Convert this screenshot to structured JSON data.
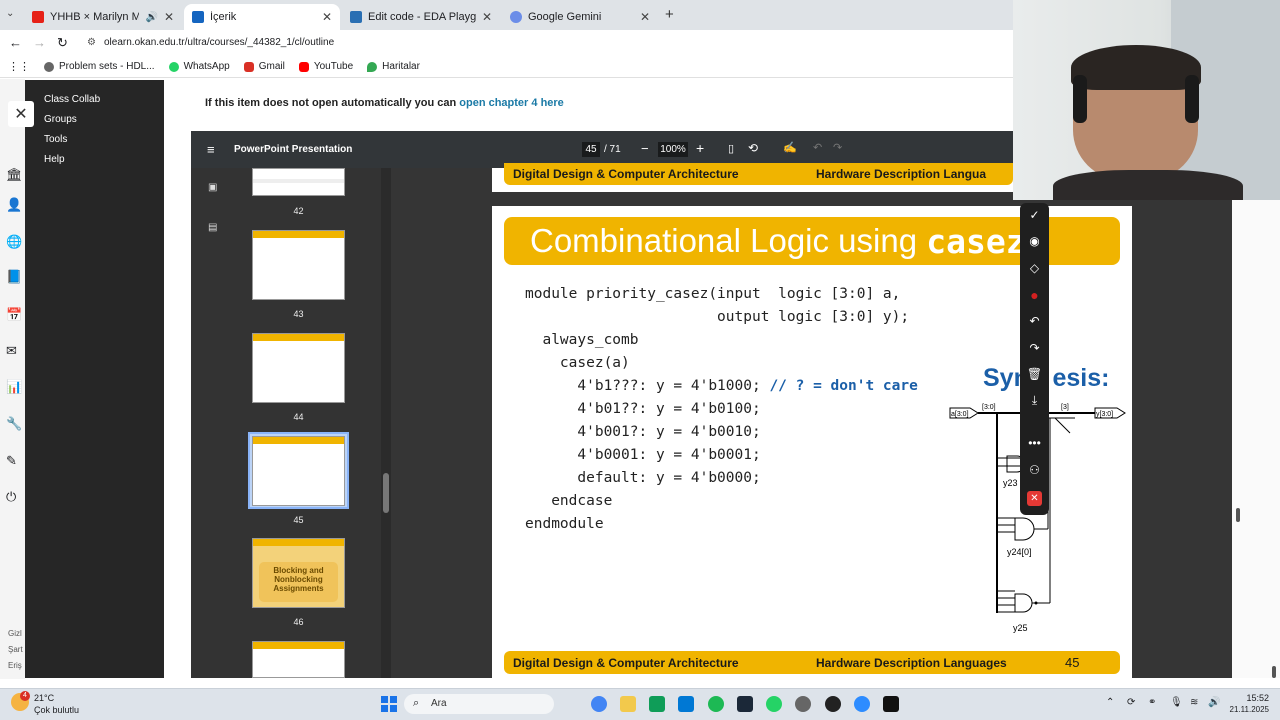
{
  "browser": {
    "tabs": [
      {
        "title": "YHHB × Marilyn Manson (n",
        "active": false,
        "audio": true
      },
      {
        "title": "İçerik",
        "active": true
      },
      {
        "title": "Edit code - EDA Playground",
        "active": false
      },
      {
        "title": "Google Gemini",
        "active": false
      }
    ],
    "url": "olearn.okan.edu.tr/ultra/courses/_44382_1/cl/outline",
    "bookmarks": [
      "Problem sets - HDL...",
      "WhatsApp",
      "Gmail",
      "YouTube",
      "Haritalar"
    ]
  },
  "course_menu": {
    "items": [
      "Class Collab",
      "Groups",
      "Tools",
      "Help"
    ]
  },
  "notice": {
    "text": "If this item does not open automatically you can ",
    "link": "open chapter 4 here"
  },
  "viewer": {
    "title": "PowerPoint Presentation",
    "page_current": "45",
    "page_total": "/ 71",
    "zoom": "100%",
    "thumbnails": [
      {
        "num": "42"
      },
      {
        "num": "43"
      },
      {
        "num": "44"
      },
      {
        "num": "45",
        "selected": true
      },
      {
        "num": "46",
        "caption": "Blocking and Nonblocking Assignments"
      },
      {
        "num": ""
      }
    ]
  },
  "slide": {
    "top_footer_left": "Digital Design & Computer Architecture",
    "top_footer_right": "Hardware Description Langua",
    "title_prefix": "Combinational Logic using ",
    "title_code": "casez",
    "code_lines": [
      "module priority_casez(input  logic [3:0] a,",
      "                      output logic [3:0] y);",
      "  always_comb",
      "    casez(a)",
      "      4'b1???: y = 4'b1000; ",
      "      4'b01??: y = 4'b0100;",
      "      4'b001?: y = 4'b0010;",
      "      4'b0001: y = 4'b0001;",
      "      default: y = 4'b0000;",
      "   endcase",
      "endmodule"
    ],
    "comment": "// ? = don't care",
    "synthesis_label": "Synthesis:",
    "synthesis_label_hidden_part": "Syn",
    "synthesis_label_visible": "esis:",
    "circuit_labels": {
      "in": "a[3:0]",
      "in_bus": "[3:0]",
      "out_bus": "[3]",
      "out": "y[3:0]",
      "y23": "y23",
      "y24": "y24[0]",
      "y25": "y25"
    },
    "footer_left": "Digital Design & Computer Architecture",
    "footer_right": "Hardware Description Languages",
    "page_number": "45"
  },
  "taskbar": {
    "weather_temp": "21°C",
    "weather_desc": "Çok bulutlu",
    "search_placeholder": "Ara",
    "time": "15:52",
    "date": "21.11.2025",
    "notification_badge": "4"
  },
  "left_cut_labels": [
    "Gizl",
    "Şart",
    "Eriş"
  ],
  "colors": {
    "slide_yellow": "#f0b400",
    "synthesis_blue": "#1b5fa8",
    "dark_menu": "#262626"
  }
}
